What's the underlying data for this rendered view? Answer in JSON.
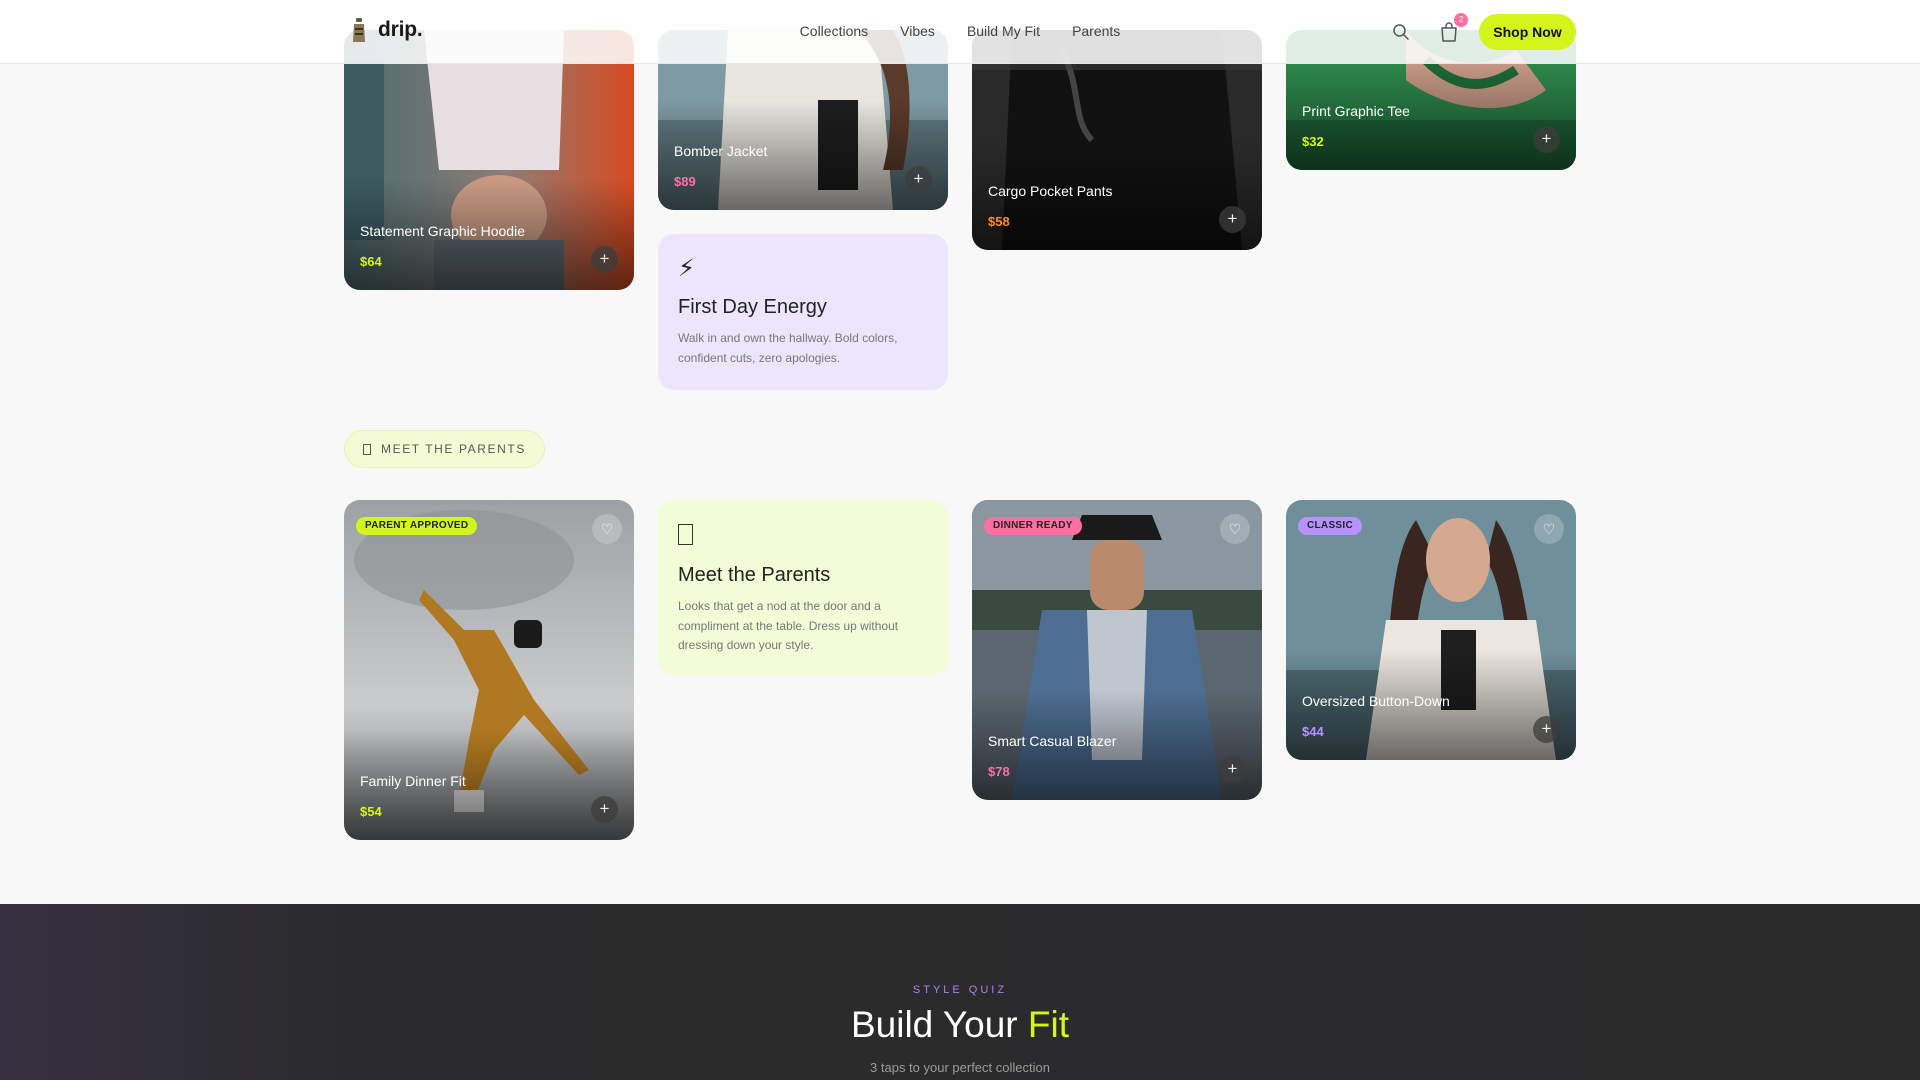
{
  "header": {
    "logo_text": "drip.",
    "nav": [
      "Collections",
      "Vibes",
      "Build My Fit",
      "Parents"
    ],
    "cart_count": "2",
    "shop_button": "Shop Now"
  },
  "colors": {
    "accent": "#d4f51c",
    "pink": "#ff6fa2",
    "purple": "#a486f0",
    "orange": "#ff8a2b"
  },
  "vibes_products": [
    {
      "name": "Statement Graphic Hoodie",
      "price": "$64",
      "price_color": "#d4f51c"
    },
    {
      "name": "Bomber Jacket",
      "price": "$89",
      "price_color": "#ff6fa2"
    },
    {
      "name": "Cargo Pocket Pants",
      "price": "$58",
      "price_color": "#ff8a2b"
    },
    {
      "name": "Print Graphic Tee",
      "price": "$32",
      "price_color": "#d4f51c"
    }
  ],
  "first_day": {
    "icon": "lightning-icon",
    "title": "First Day Energy",
    "text": "Walk in and own the hallway. Bold colors, confident cuts, zero apologies."
  },
  "parents_section": {
    "pill_label": "MEET THE PARENTS",
    "info": {
      "icon": "phone-icon",
      "title": "Meet the Parents",
      "text": "Looks that get a nod at the door and a compliment at the table. Dress up without dressing down your style."
    },
    "products": [
      {
        "name": "Family Dinner Fit",
        "price": "$54",
        "tag": "PARENT APPROVED ",
        "price_color": "#d4f51c",
        "tag_color": "#d4f51c"
      },
      {
        "name": "Smart Casual Blazer",
        "price": "$78",
        "tag": "DINNER READY",
        "price_color": "#ff6fa2",
        "tag_color": "#ff6fa2"
      },
      {
        "name": "Oversized Button-Down",
        "price": "$44",
        "tag": "CLASSIC",
        "price_color": "#b892ff",
        "tag_color": "#b892ff"
      }
    ]
  },
  "quiz": {
    "kicker": "STYLE QUIZ",
    "title_main": "Build Your ",
    "title_accent": "Fit",
    "subtitle": "3 taps to your perfect collection"
  }
}
